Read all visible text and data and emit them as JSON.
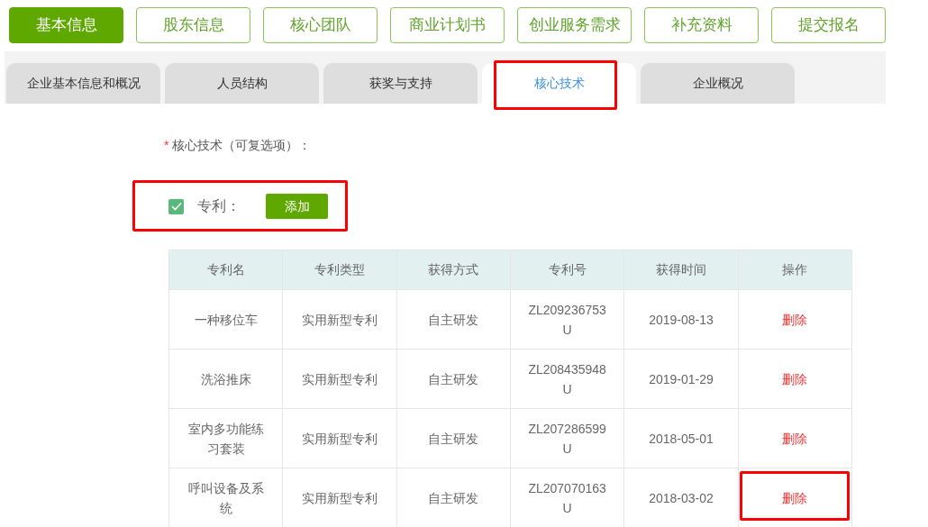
{
  "steps": [
    {
      "label": "基本信息",
      "selected": true
    },
    {
      "label": "股东信息",
      "selected": false
    },
    {
      "label": "核心团队",
      "selected": false
    },
    {
      "label": "商业计划书",
      "selected": false
    },
    {
      "label": "创业服务需求",
      "selected": false
    },
    {
      "label": "补充资料",
      "selected": false
    },
    {
      "label": "提交报名",
      "selected": false
    }
  ],
  "tabs": [
    {
      "label": "企业基本信息和概况",
      "selected": false,
      "highlighted": false
    },
    {
      "label": "人员结构",
      "selected": false,
      "highlighted": false
    },
    {
      "label": "获奖与支持",
      "selected": false,
      "highlighted": false
    },
    {
      "label": "核心技术",
      "selected": true,
      "highlighted": true
    },
    {
      "label": "企业概况",
      "selected": false,
      "highlighted": false
    }
  ],
  "form": {
    "required_mark": "*",
    "label": "核心技术（可复选项）：",
    "patent": {
      "label": "专利：",
      "checked": true,
      "add_button": "添加",
      "highlighted": true
    }
  },
  "table": {
    "columns": [
      "专利名",
      "专利类型",
      "获得方式",
      "专利号",
      "获得时间",
      "操作"
    ],
    "rows": [
      {
        "name": "一种移位车",
        "type": "实用新型专利",
        "method": "自主研发",
        "number": "ZL209236753U",
        "date": "2019-08-13",
        "action": "删除",
        "highlighted": false
      },
      {
        "name": "洗浴推床",
        "type": "实用新型专利",
        "method": "自主研发",
        "number": "ZL208435948U",
        "date": "2019-01-29",
        "action": "删除",
        "highlighted": false
      },
      {
        "name": "室内多功能练习套装",
        "type": "实用新型专利",
        "method": "自主研发",
        "number": "ZL207286599U",
        "date": "2018-05-01",
        "action": "删除",
        "highlighted": false
      },
      {
        "name": "呼叫设备及系统",
        "type": "实用新型专利",
        "method": "自主研发",
        "number": "ZL207070163U",
        "date": "2018-03-02",
        "action": "删除",
        "highlighted": true
      }
    ]
  }
}
